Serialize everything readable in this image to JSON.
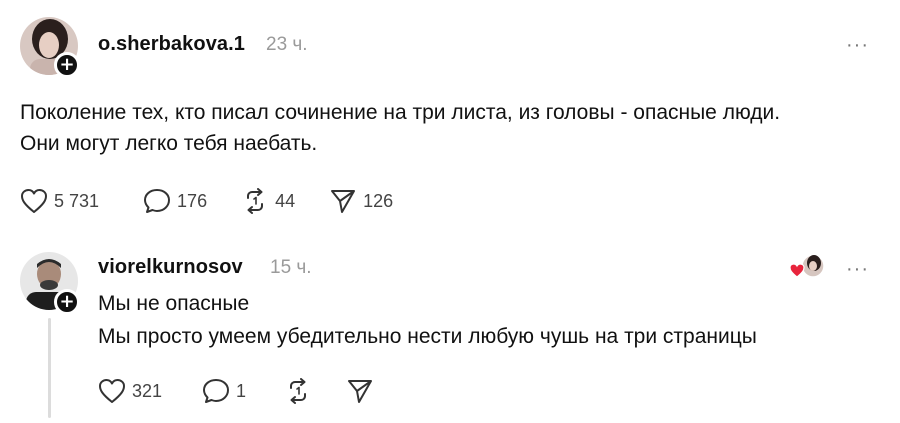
{
  "post": {
    "username": "o.sherbakova.1",
    "time": "23 ч.",
    "more_label": "···",
    "text_line1": "Поколение тех, кто писал сочинение на три листа, из головы - опасные люди.",
    "text_line2": "Они могут легко тебя наебать.",
    "likes": "5 731",
    "comments": "176",
    "reposts": "44",
    "shares": "126"
  },
  "reply": {
    "username": "viorelkurnosov",
    "time": "15 ч.",
    "more_label": "···",
    "text_line1": "Мы не опасные",
    "text_line2": "Мы просто умеем убедительно нести любую чушь на три страницы",
    "likes": "321",
    "comments": "1"
  },
  "icons": {
    "follow": "plus-icon",
    "like": "heart-icon",
    "comment": "comment-bubble-icon",
    "repost": "repost-icon",
    "share": "send-icon",
    "liked_by_author": "red-heart-icon"
  },
  "colors": {
    "text": "#111111",
    "muted": "#9a9a9a",
    "icon": "#444444",
    "liked_heart": "#e8243c"
  }
}
